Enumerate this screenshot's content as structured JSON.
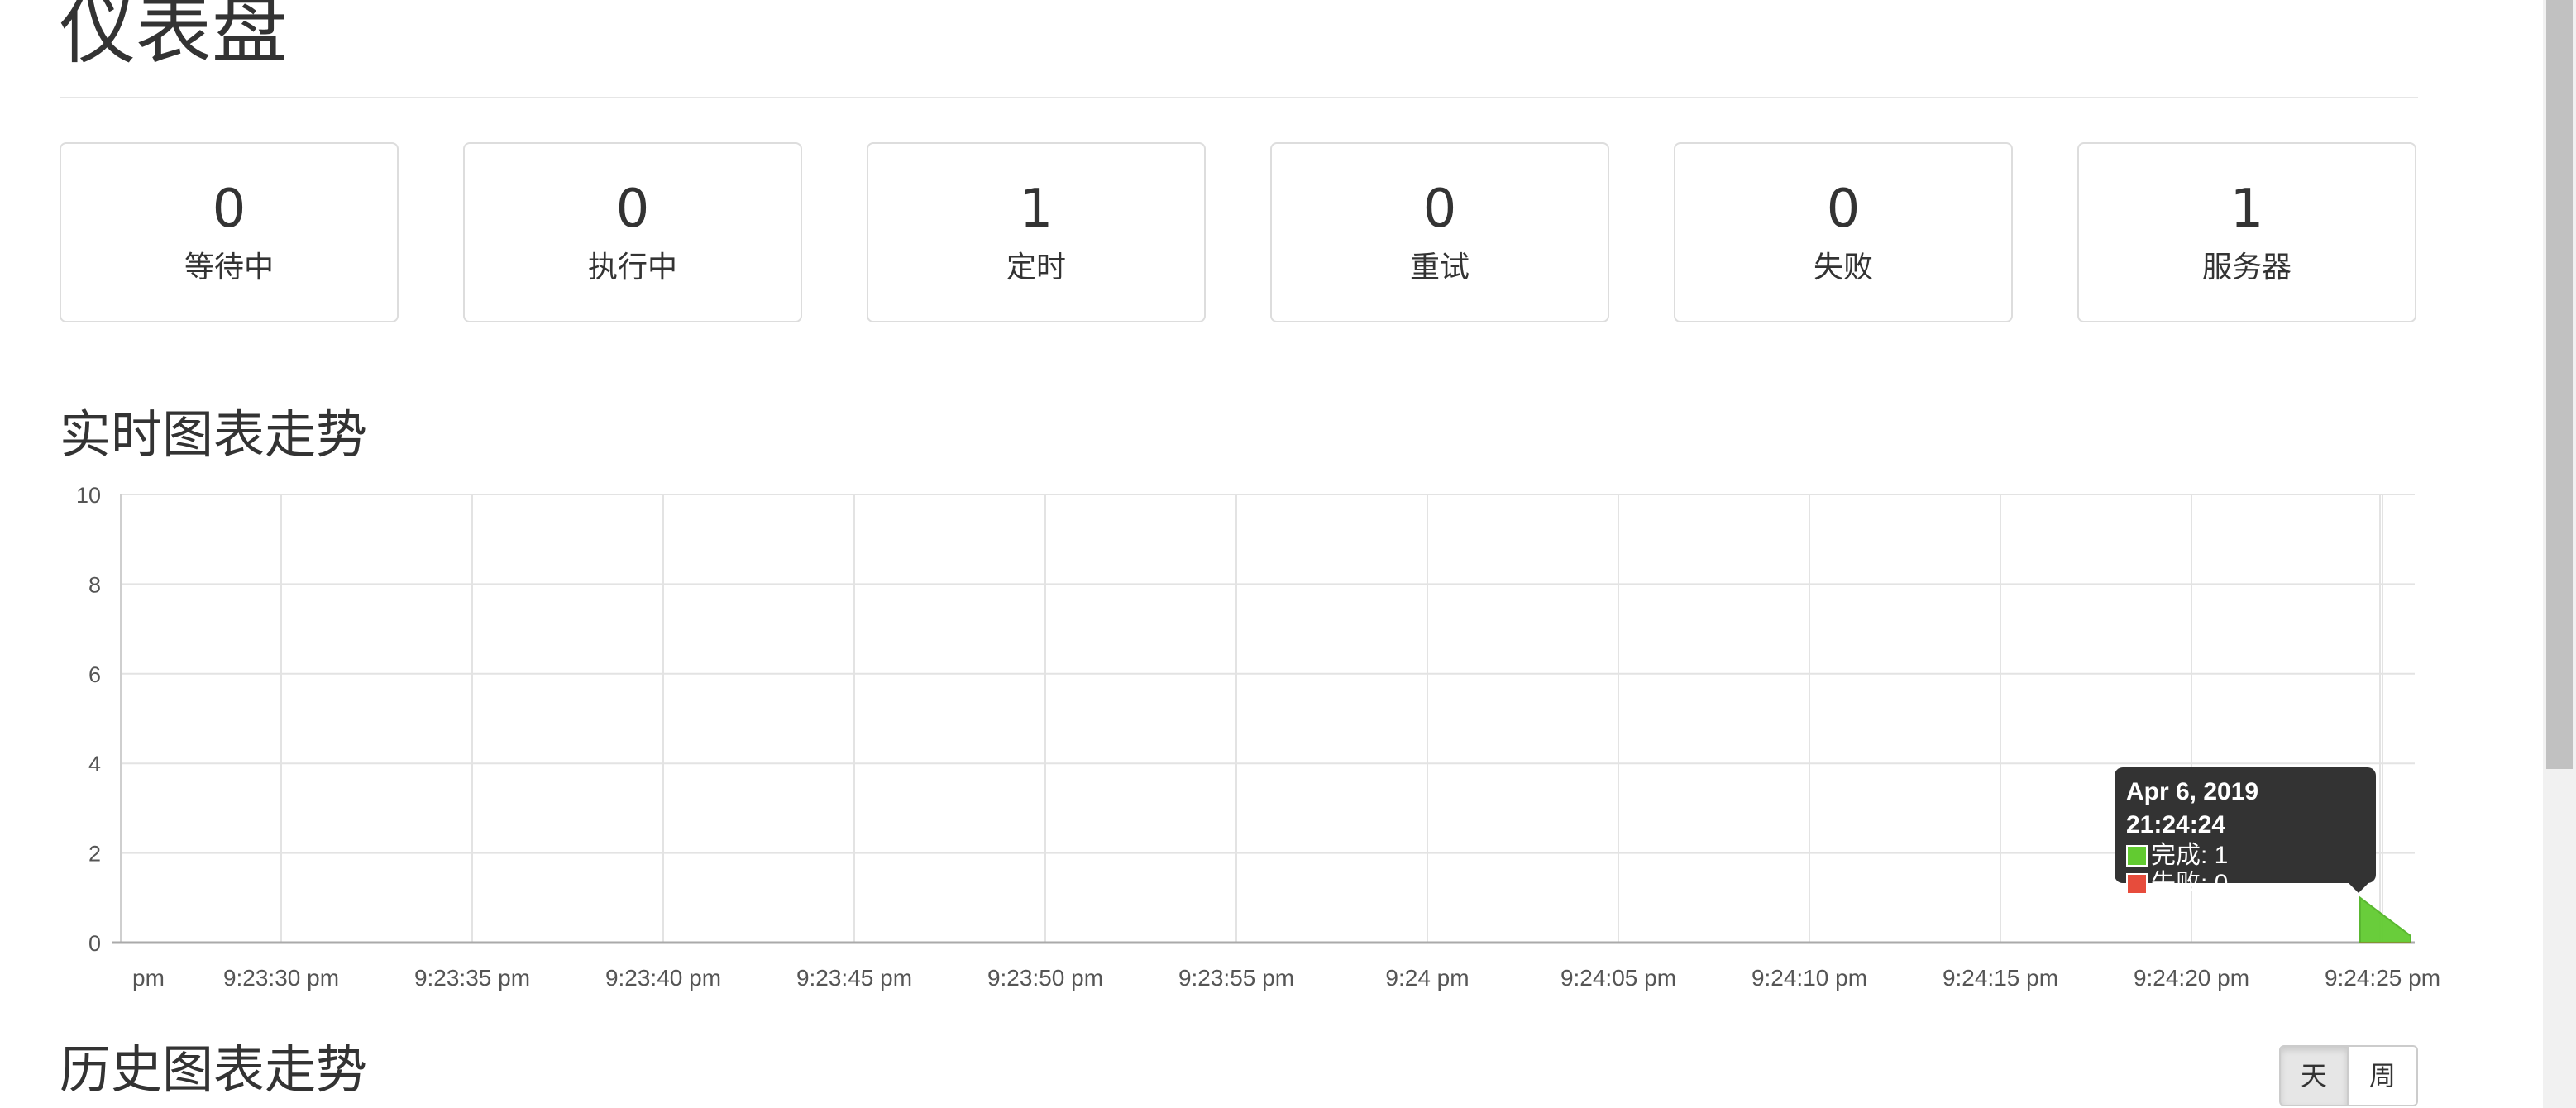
{
  "page": {
    "title": "仪表盘"
  },
  "stats": [
    {
      "value": "0",
      "label": "等待中"
    },
    {
      "value": "0",
      "label": "执行中"
    },
    {
      "value": "1",
      "label": "定时"
    },
    {
      "value": "0",
      "label": "重试"
    },
    {
      "value": "0",
      "label": "失败"
    },
    {
      "value": "1",
      "label": "服务器"
    }
  ],
  "realtime": {
    "title": "实时图表走势",
    "tooltip": {
      "title": "Apr 6, 2019 21:24:24",
      "rows": [
        {
          "label": "完成: 1",
          "color": "#62cb31"
        },
        {
          "label": "失败: 0",
          "color": "#e74c3c"
        }
      ]
    }
  },
  "history": {
    "title": "历史图表走势",
    "range_buttons": [
      "天",
      "周"
    ],
    "active_range": "天"
  },
  "colors": {
    "success": "#62cb31",
    "failure": "#e74c3c",
    "grid": "#e3e3e3"
  },
  "chart_data": {
    "type": "area",
    "x_tick_labels": [
      "pm",
      "9:23:30 pm",
      "9:23:35 pm",
      "9:23:40 pm",
      "9:23:45 pm",
      "9:23:50 pm",
      "9:23:55 pm",
      "9:24 pm",
      "9:24:05 pm",
      "9:24:10 pm",
      "9:24:15 pm",
      "9:24:20 pm",
      "9:24:25 pm"
    ],
    "y_ticks": [
      0,
      2,
      4,
      6,
      8,
      10
    ],
    "ylim": [
      0,
      10
    ],
    "series": [
      {
        "name": "完成",
        "points": [
          [
            "9:24:24 pm",
            1
          ],
          [
            "9:24:25 pm",
            0
          ]
        ]
      },
      {
        "name": "失败",
        "points": [
          [
            "9:24:24 pm",
            0
          ],
          [
            "9:24:25 pm",
            0
          ]
        ]
      }
    ]
  }
}
